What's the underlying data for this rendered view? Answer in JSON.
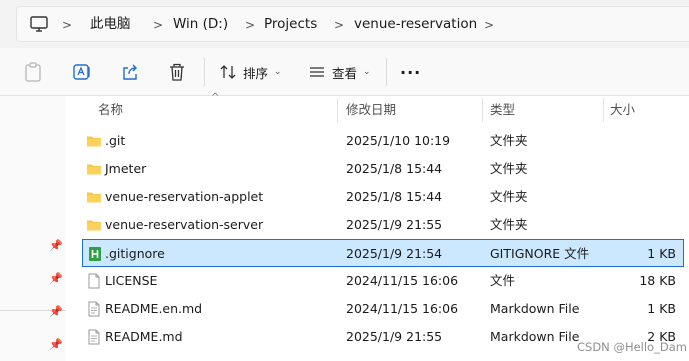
{
  "breadcrumb": {
    "icon": "computer-icon",
    "items": [
      "此电脑",
      "Win (D:)",
      "Projects",
      "venue-reservation"
    ]
  },
  "toolbar": {
    "sort_label": "排序",
    "view_label": "查看",
    "more_label": "···"
  },
  "columns": {
    "name": "名称",
    "modified": "修改日期",
    "type": "类型",
    "size": "大小"
  },
  "files": [
    {
      "name": ".git",
      "modified": "2025/1/10 10:19",
      "type": "文件夹",
      "size": "",
      "icon": "folder-icon",
      "selected": false
    },
    {
      "name": "Jmeter",
      "modified": "2025/1/8 15:44",
      "type": "文件夹",
      "size": "",
      "icon": "folder-icon",
      "selected": false
    },
    {
      "name": "venue-reservation-applet",
      "modified": "2025/1/8 15:44",
      "type": "文件夹",
      "size": "",
      "icon": "folder-icon",
      "selected": false
    },
    {
      "name": "venue-reservation-server",
      "modified": "2025/1/9 21:55",
      "type": "文件夹",
      "size": "",
      "icon": "folder-icon",
      "selected": false
    },
    {
      "name": ".gitignore",
      "modified": "2025/1/9 21:54",
      "type": "GITIGNORE 文件",
      "size": "1 KB",
      "icon": "gitignore-file-icon",
      "selected": true
    },
    {
      "name": "LICENSE",
      "modified": "2024/11/15 16:06",
      "type": "文件",
      "size": "18 KB",
      "icon": "blank-file-icon",
      "selected": false
    },
    {
      "name": "README.en.md",
      "modified": "2024/11/15 16:06",
      "type": "Markdown File",
      "size": "1 KB",
      "icon": "markdown-file-icon",
      "selected": false
    },
    {
      "name": "README.md",
      "modified": "2025/1/9 21:55",
      "type": "Markdown File",
      "size": "2 KB",
      "icon": "markdown-file-icon",
      "selected": false
    }
  ],
  "colors": {
    "selection_bg": "#cce8ff",
    "selection_border": "#1f6fd1",
    "folder": "#f8c84a",
    "gitignore_icon": "#2ea043"
  },
  "watermark": "CSDN @Hello_Dam"
}
